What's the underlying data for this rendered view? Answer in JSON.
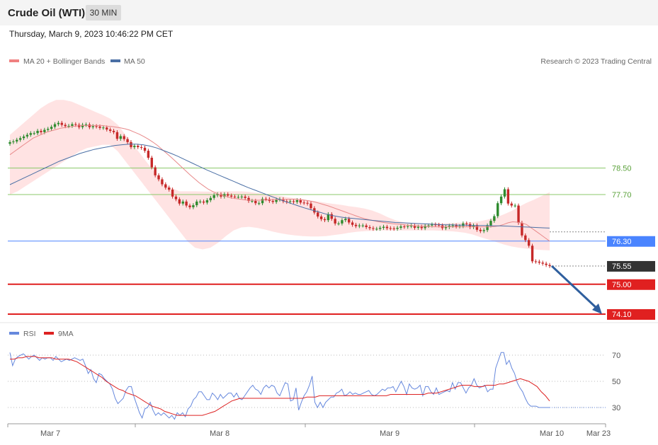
{
  "header": {
    "title": "Crude Oil (WTI)",
    "timeframe": "30 MIN",
    "timestamp": "Thursday, March 9, 2023 10:46:22 PM CET"
  },
  "legend": {
    "ma20": "MA 20 + Bollinger Bands",
    "ma50": "MA 50",
    "credit": "Research © 2023 Trading Central",
    "rsi": "RSI",
    "ma9": "9MA"
  },
  "colors": {
    "bull": "#2e8b2e",
    "bear": "#c62828",
    "ma20": "#f08080",
    "bollinger_fill": "#ffe3e3",
    "ma50": "#4a6fa5",
    "resistance": "#8cc96b",
    "pivot": "#4a84ff",
    "support": "#e02020",
    "current_badge": "#333333",
    "arrow": "#2f5f9e",
    "rsi": "#6688dd",
    "rsi_ma": "#dd2222"
  },
  "chart_data": [
    {
      "type": "candlestick",
      "title": "Crude Oil (WTI)",
      "x_ticks": [
        "Mar 7",
        "Mar 8",
        "Mar 9",
        "Mar 10",
        "Mar 23"
      ],
      "price_levels": [
        {
          "value": 78.5,
          "label": "78.50",
          "kind": "resistance"
        },
        {
          "value": 77.7,
          "label": "77.70",
          "kind": "resistance"
        },
        {
          "value": 76.3,
          "label": "76.30",
          "kind": "pivot"
        },
        {
          "value": 75.55,
          "label": "75.55",
          "kind": "current"
        },
        {
          "value": 75.0,
          "label": "75.00",
          "kind": "support"
        },
        {
          "value": 74.1,
          "label": "74.10",
          "kind": "support"
        }
      ],
      "close": [
        79.28,
        79.3,
        79.35,
        79.4,
        79.45,
        79.5,
        79.55,
        79.55,
        79.62,
        79.58,
        79.65,
        79.68,
        79.74,
        79.82,
        79.86,
        79.8,
        79.76,
        79.77,
        79.82,
        79.8,
        79.73,
        79.8,
        79.81,
        79.73,
        79.76,
        79.75,
        79.71,
        79.72,
        79.66,
        79.62,
        79.58,
        79.38,
        79.46,
        79.37,
        79.28,
        79.13,
        79.17,
        79.13,
        79.11,
        79.02,
        78.81,
        78.52,
        78.28,
        78.16,
        78.01,
        77.91,
        77.85,
        77.64,
        77.56,
        77.43,
        77.49,
        77.37,
        77.32,
        77.38,
        77.49,
        77.49,
        77.46,
        77.53,
        77.6,
        77.68,
        77.71,
        77.64,
        77.71,
        77.67,
        77.64,
        77.63,
        77.63,
        77.64,
        77.6,
        77.51,
        77.51,
        77.44,
        77.44,
        77.57,
        77.56,
        77.51,
        77.48,
        77.55,
        77.56,
        77.5,
        77.48,
        77.5,
        77.48,
        77.53,
        77.46,
        77.45,
        77.43,
        77.29,
        77.16,
        77.04,
        76.96,
        76.93,
        77.11,
        76.97,
        76.83,
        76.83,
        76.93,
        76.97,
        76.86,
        76.79,
        76.75,
        76.77,
        76.77,
        76.72,
        76.69,
        76.67,
        76.67,
        76.7,
        76.73,
        76.69,
        76.68,
        76.67,
        76.7,
        76.74,
        76.73,
        76.75,
        76.76,
        76.7,
        76.73,
        76.69,
        76.76,
        76.77,
        76.8,
        76.79,
        76.77,
        76.69,
        76.72,
        76.76,
        76.77,
        76.74,
        76.75,
        76.83,
        76.81,
        76.72,
        76.77,
        76.64,
        76.6,
        76.63,
        76.77,
        76.91,
        77.05,
        77.44,
        77.64,
        77.86,
        77.43,
        77.37,
        77.37,
        76.85,
        76.47,
        76.33,
        76.16,
        75.69,
        75.68,
        75.65,
        75.62,
        75.58,
        75.55
      ],
      "ma20": [
        78.9,
        79.0,
        79.1,
        79.2,
        79.3,
        79.4,
        79.46,
        79.52,
        79.58,
        79.62,
        79.66,
        79.7,
        79.72,
        79.74,
        79.76,
        79.77,
        79.78,
        79.78,
        79.78,
        79.78,
        79.78,
        79.76,
        79.75,
        79.73,
        79.71,
        79.68,
        79.64,
        79.58,
        79.52,
        79.45,
        79.37,
        79.28,
        79.18,
        79.06,
        78.94,
        78.82,
        78.69,
        78.56,
        78.43,
        78.3,
        78.18,
        78.06,
        77.96,
        77.86,
        77.79,
        77.72,
        77.68,
        77.64,
        77.6,
        77.58,
        77.56,
        77.54,
        77.53,
        77.53,
        77.53,
        77.54,
        77.54,
        77.55,
        77.55,
        77.55,
        77.56,
        77.56,
        77.56,
        77.55,
        77.53,
        77.51,
        77.48,
        77.44,
        77.4,
        77.36,
        77.31,
        77.26,
        77.21,
        77.16,
        77.11,
        77.06,
        77.01,
        76.97,
        76.94,
        76.91,
        76.88,
        76.86,
        76.84,
        76.82,
        76.81,
        76.8,
        76.78,
        76.77,
        76.76,
        76.75,
        76.74,
        76.74,
        76.73,
        76.73,
        76.73,
        76.73,
        76.73,
        76.73,
        76.73,
        76.73,
        76.73,
        76.73,
        76.73,
        76.73,
        76.73,
        76.74,
        76.76,
        76.8,
        76.85,
        76.88,
        76.87,
        76.84,
        76.8,
        76.7,
        76.6,
        76.5,
        76.4,
        76.3
      ],
      "ma50": [
        78.0,
        78.1,
        78.2,
        78.3,
        78.4,
        78.5,
        78.6,
        78.7,
        78.78,
        78.86,
        78.94,
        79.0,
        79.06,
        79.1,
        79.14,
        79.18,
        79.2,
        79.22,
        79.22,
        79.2,
        79.16,
        79.1,
        79.02,
        78.94,
        78.85,
        78.75,
        78.65,
        78.55,
        78.45,
        78.36,
        78.27,
        78.18,
        78.09,
        78.0,
        77.91,
        77.83,
        77.75,
        77.67,
        77.59,
        77.51,
        77.44,
        77.37,
        77.3,
        77.24,
        77.18,
        77.12,
        77.07,
        77.03,
        77.0,
        76.98,
        76.96,
        76.94,
        76.92,
        76.9,
        76.88,
        76.86,
        76.85,
        76.84,
        76.83,
        76.82,
        76.81,
        76.8,
        76.79,
        76.79,
        76.78,
        76.78,
        76.77,
        76.77,
        76.77,
        76.76,
        76.76,
        76.75,
        76.74,
        76.73,
        76.72,
        76.71,
        76.7,
        76.69
      ],
      "bb_upper": [
        79.5,
        79.7,
        79.9,
        80.1,
        80.3,
        80.45,
        80.55,
        80.55,
        80.5,
        80.4,
        80.3,
        80.2,
        80.1,
        79.99,
        79.8,
        79.5,
        79.2,
        78.9,
        78.6,
        78.3,
        78.0,
        77.9,
        77.8,
        77.8,
        77.8,
        77.79,
        77.79,
        77.8,
        77.8,
        77.8,
        77.8,
        77.78,
        77.75,
        77.72,
        77.69,
        77.66,
        77.62,
        77.59,
        77.56,
        77.52,
        77.49,
        77.45,
        77.42,
        77.39,
        77.35,
        77.32,
        77.28,
        77.22,
        77.13,
        77.02,
        76.93,
        76.87,
        76.84,
        76.82,
        76.82,
        76.83,
        76.83,
        76.84,
        76.85,
        76.86,
        76.87,
        76.9,
        76.95,
        77.01,
        77.1,
        77.2,
        77.33,
        77.45,
        77.55,
        77.66,
        77.77
      ],
      "bb_lower": [
        77.7,
        77.8,
        77.95,
        78.1,
        78.25,
        78.4,
        78.55,
        78.7,
        78.85,
        79.0,
        79.1,
        79.15,
        79.2,
        79.2,
        79.0,
        78.7,
        78.4,
        78.1,
        77.8,
        77.5,
        77.2,
        76.9,
        76.6,
        76.3,
        76.1,
        76.05,
        76.1,
        76.25,
        76.45,
        76.62,
        76.71,
        76.73,
        76.7,
        76.65,
        76.59,
        76.54,
        76.5,
        76.47,
        76.45,
        76.44,
        76.44,
        76.45,
        76.48,
        76.51,
        76.55,
        76.58,
        76.6,
        76.61,
        76.62,
        76.62,
        76.62,
        76.62,
        76.62,
        76.62,
        76.62,
        76.62,
        76.61,
        76.6,
        76.58,
        76.55,
        76.5,
        76.42,
        76.35,
        76.28,
        76.2,
        76.14,
        76.1,
        76.07,
        76.05,
        76.03,
        76.02
      ],
      "forecast_arrow": {
        "from": 75.55,
        "to": 74.1
      }
    },
    {
      "type": "line",
      "title": "RSI",
      "y_ticks": [
        70,
        50,
        30
      ],
      "ylim": [
        20,
        80
      ],
      "series": [
        {
          "name": "RSI",
          "values": [
            72,
            62,
            67,
            69,
            70,
            71,
            69,
            67,
            69,
            70,
            68,
            66,
            68,
            67,
            68,
            68,
            66,
            69,
            67,
            65,
            66,
            67,
            66,
            67,
            68,
            67,
            66,
            67,
            62,
            56,
            59,
            52,
            49,
            56,
            55,
            52,
            50,
            48,
            44,
            37,
            33,
            35,
            37,
            43,
            46,
            46,
            38,
            32,
            26,
            22,
            29,
            30,
            34,
            28,
            24,
            26,
            24,
            26,
            24,
            22,
            24,
            21,
            26,
            24,
            26,
            23,
            29,
            31,
            36,
            38,
            42,
            42,
            39,
            36,
            36,
            41,
            39,
            36,
            40,
            37,
            39,
            41,
            41,
            38,
            41,
            37,
            36,
            39,
            42,
            45,
            47,
            44,
            43,
            40,
            45,
            47,
            45,
            47,
            46,
            41,
            39,
            44,
            49,
            48,
            35,
            36,
            45,
            28,
            34,
            39,
            42,
            47,
            54,
            34,
            30,
            34,
            30,
            34,
            36,
            38,
            38,
            41,
            42,
            44,
            39,
            40,
            42,
            40,
            41,
            40,
            40,
            41,
            42,
            43,
            40,
            39,
            40,
            42,
            44,
            43,
            45,
            45,
            46,
            42,
            46,
            50,
            46,
            40,
            48,
            45,
            44,
            45,
            47,
            39,
            46,
            46,
            42,
            40,
            45,
            40,
            41,
            42,
            43,
            42,
            49,
            44,
            49,
            49,
            45,
            41,
            45,
            47,
            52,
            47,
            45,
            46,
            47,
            42,
            44,
            44,
            60,
            66,
            72,
            72,
            63,
            66,
            60,
            56,
            49,
            45,
            42,
            37,
            33,
            31,
            31,
            31,
            30,
            30,
            30,
            30,
            30
          ]
        },
        {
          "name": "9MA",
          "values": [
            67,
            67,
            68,
            68,
            69,
            69,
            69,
            68,
            68,
            68,
            68,
            67,
            67,
            67,
            67,
            66,
            65,
            63,
            61,
            59,
            57,
            55,
            53,
            50,
            48,
            46,
            44,
            43,
            41,
            40,
            39,
            37,
            35,
            33,
            31,
            30,
            29,
            27,
            26,
            25,
            24,
            24,
            24,
            24,
            24,
            24,
            24,
            25,
            26,
            27,
            29,
            31,
            33,
            35,
            36,
            37,
            37,
            37,
            37,
            37,
            37,
            37,
            37,
            37,
            37,
            37,
            37,
            37,
            37,
            37,
            37,
            38,
            38,
            38,
            39,
            39,
            39,
            39,
            39,
            39,
            39,
            39,
            39,
            39,
            39,
            39,
            39,
            39,
            39,
            39,
            39,
            40,
            40,
            40,
            40,
            40,
            40,
            40,
            40,
            40,
            41,
            41,
            41,
            42,
            43,
            44,
            45,
            46,
            47,
            47,
            47,
            46,
            46,
            46,
            47,
            47,
            47,
            48,
            48,
            49,
            50,
            51,
            52,
            51,
            50,
            48,
            46,
            42,
            39,
            35
          ]
        }
      ]
    }
  ]
}
